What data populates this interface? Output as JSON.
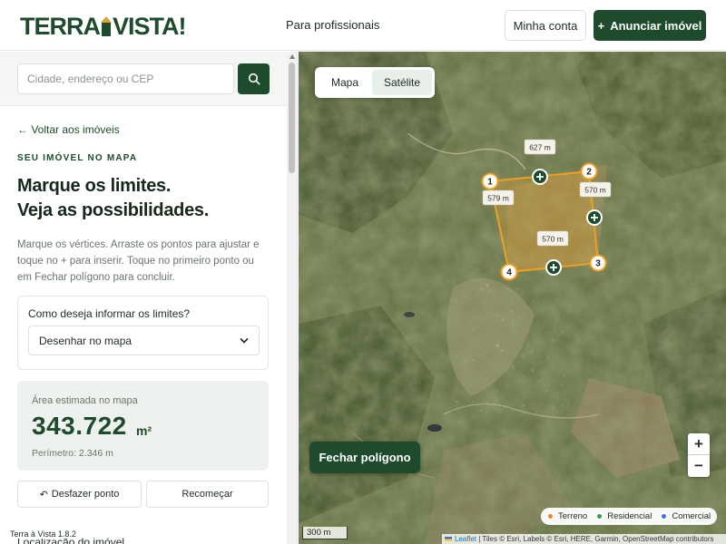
{
  "header": {
    "logo_left": "TERRA",
    "logo_right": "VISTA!",
    "nav_link": "Para profissionais",
    "account_button": "Minha conta",
    "announce_icon": "+",
    "announce_button": "Anunciar imóvel"
  },
  "sidebar": {
    "search_placeholder": "Cidade, endereço ou CEP",
    "back_link": "← Voltar aos imóveis",
    "eyebrow": "SEU IMÓVEL NO MAPA",
    "title_line1": "Marque os limites.",
    "title_line2": "Veja as possibilidades.",
    "description": "Marque os vértices. Arraste os pontos para ajustar e toque no + para inserir. Toque no primeiro ponto ou em Fechar polígono para concluir.",
    "limits_label": "Como deseja informar os limites?",
    "limits_selected": "Desenhar no mapa",
    "area_label": "Área estimada no mapa",
    "area_value": "343.722",
    "area_unit": "m²",
    "perimeter": "Perímetro: 2.346 m",
    "undo_button": "Desfazer ponto",
    "undo_icon": "↶",
    "restart_button": "Recomeçar",
    "next_section": "Localização do imóvel",
    "version": "Terra à Vista 1.8.2"
  },
  "map": {
    "toggle_map": "Mapa",
    "toggle_satellite": "Satélite",
    "active_layer": "Satélite",
    "vertices": [
      "1",
      "2",
      "3",
      "4"
    ],
    "edge_labels": [
      "627 m",
      "570 m",
      "570 m",
      "579 m"
    ],
    "close_polygon_button": "Fechar polígono",
    "zoom_in": "+",
    "zoom_out": "−",
    "legend": [
      {
        "label": "Terreno",
        "color": "#e8862a"
      },
      {
        "label": "Residencial",
        "color": "#3a9a55"
      },
      {
        "label": "Comercial",
        "color": "#3d6fd9"
      }
    ],
    "scale": "300 m",
    "attribution_link": "Leaflet",
    "attribution_text": " | Tiles © Esri, Labels © Esri, HERE, Garmin, OpenStreetMap contributors"
  },
  "colors": {
    "brand": "#1e4b2c",
    "accent": "#d9a23a",
    "polygon": "#f0a020"
  }
}
